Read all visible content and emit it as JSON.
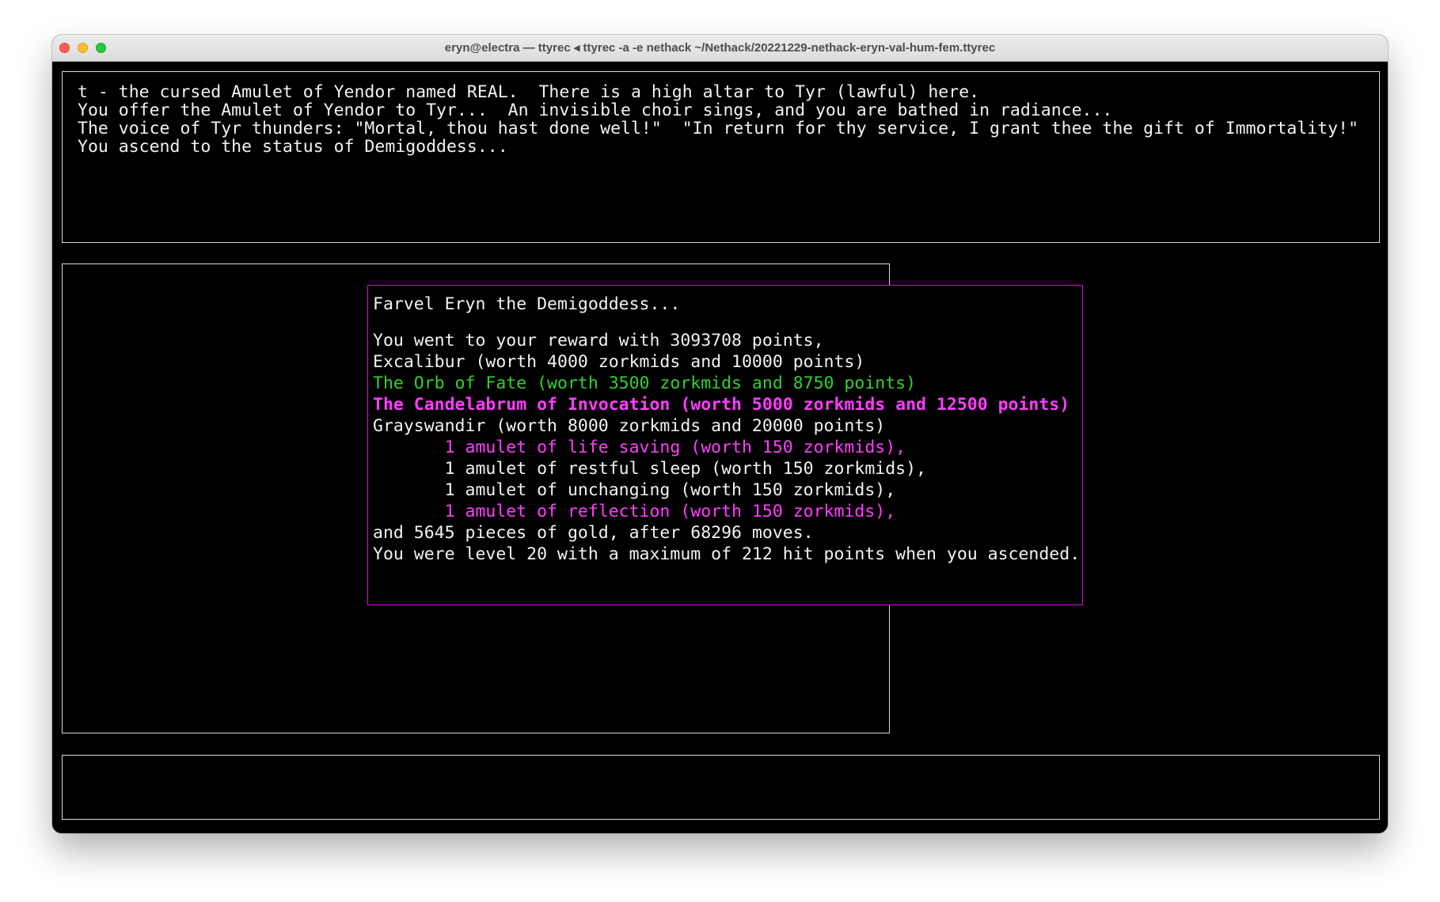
{
  "window": {
    "title": "eryn@electra — ttyrec ◂ ttyrec -a -e nethack ~/Nethack/20221229-nethack-eryn-val-hum-fem.ttyrec"
  },
  "colors": {
    "terminal_background": "#000000",
    "text": "#f2f2f2",
    "popup_border": "#e100e1",
    "highlight_green": "#2fd22f",
    "highlight_magenta": "#ff3dff"
  },
  "messages": [
    "t - the cursed Amulet of Yendor named REAL.  There is a high altar to Tyr (lawful) here.",
    "You offer the Amulet of Yendor to Tyr...  An invisible choir sings, and you are bathed in radiance...",
    "The voice of Tyr thunders: \"Mortal, thou hast done well!\"  \"In return for thy service, I grant thee the gift of Immortality!\"",
    "You ascend to the status of Demigoddess..."
  ],
  "farewell": {
    "greeting": "Farvel Eryn the Demigoddess...",
    "reward": "You went to your reward with 3093708 points,",
    "excalibur": "Excalibur (worth 4000 zorkmids and 10000 points)",
    "orb": "The Orb of Fate (worth 3500 zorkmids and 8750 points)",
    "candelabrum": "The Candelabrum of Invocation (worth 5000 zorkmids and 12500 points)",
    "grayswandir": "Grayswandir (worth 8000 zorkmids and 20000 points)",
    "amulet_life_saving": "       1 amulet of life saving (worth 150 zorkmids),",
    "amulet_restful_sleep": "       1 amulet of restful sleep (worth 150 zorkmids),",
    "amulet_unchanging": "       1 amulet of unchanging (worth 150 zorkmids),",
    "amulet_reflection": "       1 amulet of reflection (worth 150 zorkmids),",
    "gold": "and 5645 pieces of gold, after 68296 moves.",
    "level": "You were level 20 with a maximum of 212 hit points when you ascended."
  }
}
